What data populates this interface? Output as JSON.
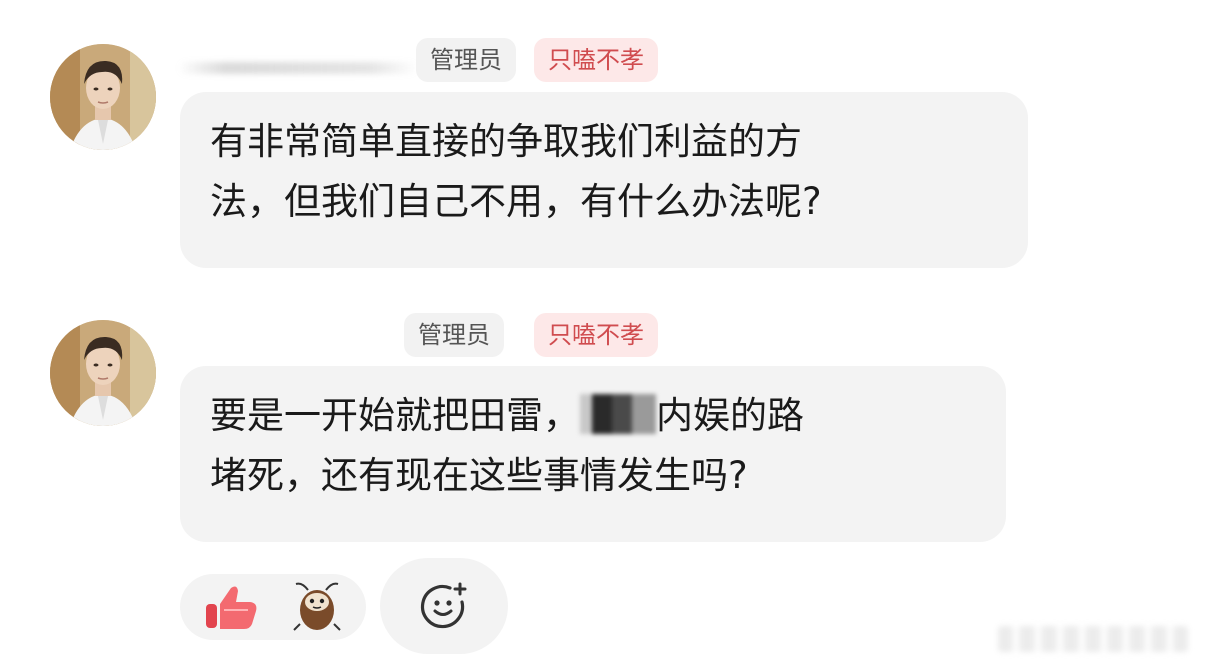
{
  "comments": [
    {
      "role_tag": "管理员",
      "title_tag": "只嗑不孝",
      "lines": [
        "有非常简单直接的争取我们利益的方",
        "法，但我们自己不用，有什么办法呢?"
      ]
    },
    {
      "role_tag": "管理员",
      "title_tag": "只嗑不孝",
      "line1_before": "要是一开始就把田雷，",
      "line1_after": "内娱的路",
      "line2": "堵死，还有现在这些事情发生吗?"
    }
  ],
  "reactions": {
    "items": [
      "thumbs-up-icon",
      "cockroach-sticker-icon"
    ],
    "add": "add-reaction-icon"
  },
  "colors": {
    "bubble": "#f3f3f3",
    "admin_tag": "#f2f2f2",
    "title_tag_bg": "#fde8e8",
    "title_tag_text": "#d04c4f"
  }
}
